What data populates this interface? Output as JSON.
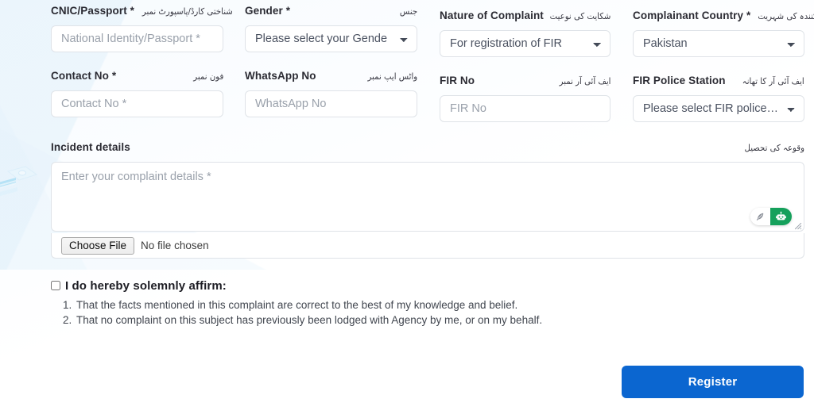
{
  "form": {
    "fields_row1": [
      {
        "label_en": "CNIC/Passport *",
        "label_ur": "شناختی کارڈ/پاسپورٹ نمبر",
        "control": "input",
        "placeholder": "National Identity/Passport *",
        "value": ""
      },
      {
        "label_en": "Gender *",
        "label_ur": "جنس",
        "control": "select",
        "selected": "Please select your Gende",
        "value": ""
      },
      {
        "label_en": "Nature of Complaint",
        "label_ur": "شکایت کی نوعیت",
        "control": "select",
        "selected": "For registration of FIR",
        "value": ""
      },
      {
        "label_en": "Complainant Country *",
        "label_ur": "شکایت کنندہ کی شہریت",
        "control": "select",
        "selected": "Pakistan",
        "value": ""
      }
    ],
    "fields_row2": [
      {
        "label_en": "Contact No *",
        "label_ur": "فون نمبر",
        "control": "input",
        "placeholder": "Contact No *",
        "value": ""
      },
      {
        "label_en": "WhatsApp No",
        "label_ur": "واٹس ایپ نمبر",
        "control": "input",
        "placeholder": "WhatsApp No",
        "value": ""
      },
      {
        "label_en": "FIR No",
        "label_ur": "ایف آئی آر نمبر",
        "control": "input",
        "placeholder": "FIR No",
        "value": ""
      },
      {
        "label_en": "FIR Police Station",
        "label_ur": "ایف آئی آر کا تھانہ",
        "control": "select",
        "selected": "Please select FIR police s…",
        "value": ""
      }
    ],
    "incident": {
      "label_en": "Incident details",
      "label_ur": "وقوعہ کی تحصیل",
      "placeholder": "Enter your complaint details *",
      "value": ""
    },
    "file_upload": {
      "button_label": "Choose File",
      "status_text": "No file chosen"
    },
    "affirm": {
      "title": "I do hereby solemnly affirm:",
      "checked": false,
      "items": [
        "That the facts mentioned in this complaint are correct to the best of my knowledge and belief.",
        "That no complaint on this subject has previously been lodged with Agency by me, or on my behalf."
      ]
    },
    "submit": {
      "label": "Register"
    }
  },
  "theme": {
    "accent": "#0b66d0",
    "border": "#dfe3e8",
    "placeholder": "#9aa1ab",
    "label": "#2b2b33",
    "assistant_green": "#15a05b"
  }
}
